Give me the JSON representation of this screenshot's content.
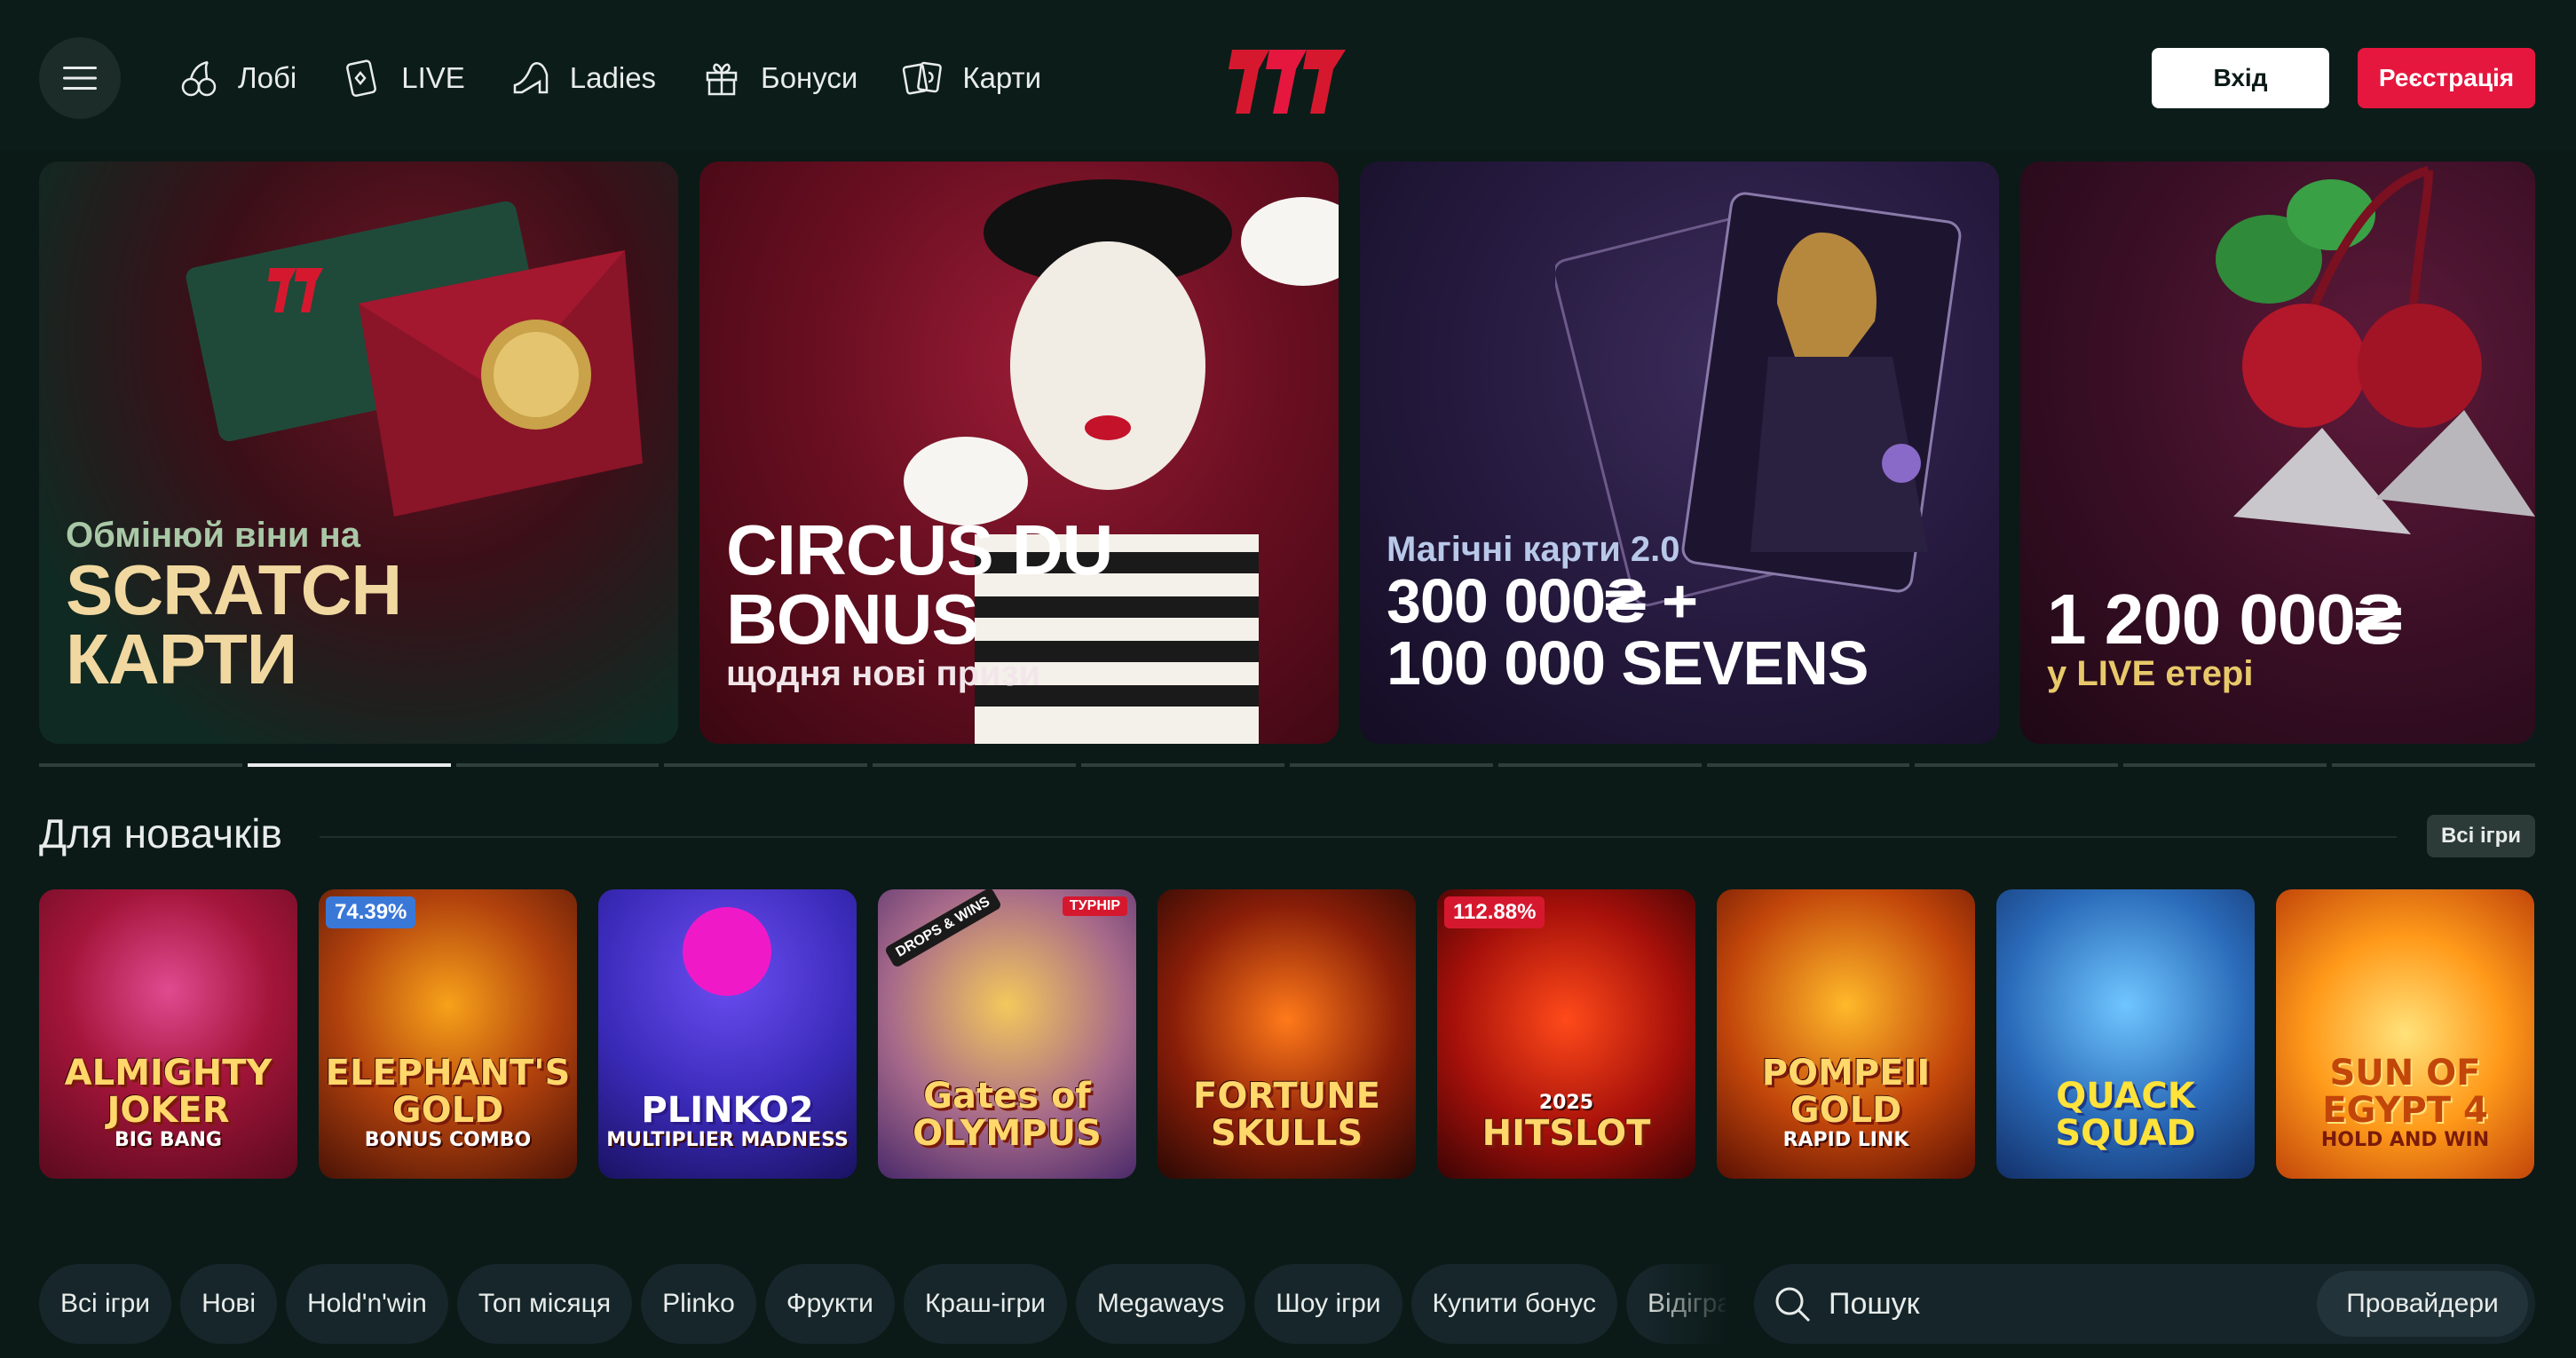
{
  "header": {
    "nav": [
      {
        "label": "Лобі",
        "icon": "cherries-icon"
      },
      {
        "label": "LIVE",
        "icon": "card-diamond-icon"
      },
      {
        "label": "Ladies",
        "icon": "high-heel-icon"
      },
      {
        "label": "Бонуси",
        "icon": "gift-icon"
      },
      {
        "label": "Карти",
        "icon": "cards-icon"
      }
    ],
    "logo_text": "777",
    "login_label": "Вхід",
    "register_label": "Реєстрація"
  },
  "colors": {
    "background": "#0b1a17",
    "accent_red": "#e5173f",
    "text": "#e8ecea"
  },
  "banners": [
    {
      "small": "Обмінюй віни на",
      "big_line1": "SCRATCH",
      "big_line2": "КАРТИ"
    },
    {
      "big_line1": "CIRCUS DU",
      "big_line2": "BONUS",
      "sub": "щодня нові призи"
    },
    {
      "small": "Магічні карти 2.0",
      "big_line1": "300 000₴ +",
      "big_line2": "100 000 SEVENS"
    },
    {
      "big_line1": "1 200 000₴",
      "sub": "у LIVE етері"
    }
  ],
  "carousel": {
    "slides": 12,
    "active_index": 1
  },
  "section": {
    "title": "Для новачків",
    "all_games_label": "Всі ігри"
  },
  "games": [
    {
      "title": "ALMIGHTY JOKER",
      "subtitle": "BIG BANG"
    },
    {
      "title": "ELEPHANT'S GOLD",
      "subtitle": "BONUS COMBO",
      "badge": "74.39%"
    },
    {
      "title": "PLINKO2",
      "subtitle": "MULTIPLIER MADNESS"
    },
    {
      "title": "Gates of OLYMPUS",
      "subtitle": "",
      "badge": "DROPS & WINS",
      "tag": "ТУРНІР"
    },
    {
      "title": "FORTUNE SKULLS",
      "subtitle": ""
    },
    {
      "title": "HITSLOT",
      "subtitle": "2025",
      "badge": "112.88%"
    },
    {
      "title": "POMPEII GOLD",
      "subtitle": "RAPID LINK"
    },
    {
      "title": "QUACK SQUAD",
      "subtitle": ""
    },
    {
      "title": "SUN OF EGYPT 4",
      "subtitle": "HOLD AND WIN"
    }
  ],
  "filters": [
    "Всі ігри",
    "Нові",
    "Hold'n'win",
    "Топ місяця",
    "Plinko",
    "Фрукти",
    "Краш-ігри",
    "Megaways",
    "Шоу ігри",
    "Купити бонус",
    "Відіграш бонусу"
  ],
  "search": {
    "placeholder": "Пошук",
    "providers_label": "Провайдери"
  }
}
